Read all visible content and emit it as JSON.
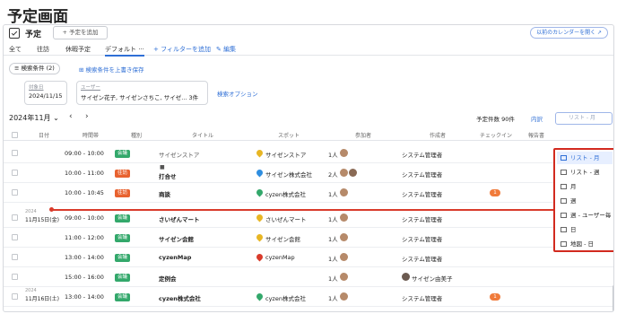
{
  "page_title": "予定画面",
  "header": {
    "title": "予定",
    "add_button": "+ 予定を追加",
    "prev_calendar_button": "以前のカレンダーを開く ↗"
  },
  "tabs": [
    "全て",
    "往訪",
    "休暇予定",
    "デフォルト ···",
    "+ フィルターを追加",
    "✎ 編集"
  ],
  "search": {
    "conditions_button": "≡ 検索条件 (2)",
    "save_conditions": "⊞ 検索条件を上書き保存",
    "target_date_label": "対象日",
    "target_date_value": "2024/11/15",
    "user_label": "ユーザー",
    "user_value": "サイゼン花子, サイゼンさちこ, サイゼ... 3件",
    "options_link": "検索オプション"
  },
  "toolbar": {
    "month": "2024年11月 ⌄",
    "prev": "‹",
    "next": "›",
    "count": "予定件数  90件",
    "naigai": "内訳",
    "view_select": "リスト - 月"
  },
  "table_headers": [
    "日付",
    "時間帯",
    "種別",
    "タイトル",
    "スポット",
    "参加者",
    "作成者",
    "チェックイン",
    "報告書"
  ],
  "colors": {
    "accent": "#2f6fd6",
    "kaigi": "#33a86b",
    "oubou": "#e8622f",
    "current_line": "#d93b2b",
    "dropdown_border": "#d22a1f"
  },
  "rows": [
    {
      "time": "09:00 - 10:00",
      "kind": "会議",
      "title": "サイゼンストア",
      "title_light": true,
      "spot": "サイゼンストア",
      "spot_color": "#e8b624",
      "participants": "1人",
      "creator": "システム管理者",
      "checkin": ""
    },
    {
      "time": "10:00 - 11:00",
      "kind": "往訪",
      "title": "打合せ",
      "title_light": false,
      "spot": "サイゼン株式会社",
      "spot_color": "#2f8ee0",
      "participants": "2人",
      "creator": "システム管理者",
      "checkin": ""
    },
    {
      "time": "10:00 - 10:45",
      "kind": "往訪",
      "title": "商談",
      "title_light": false,
      "spot": "cyzen株式会社",
      "spot_color": "#33a86b",
      "participants": "1人",
      "creator": "システム管理者",
      "checkin": "1"
    },
    {
      "date_year": "2024",
      "date_day": "11月15日(金)",
      "time": "09:00 - 10:00",
      "kind": "会議",
      "title": "さいぜんマート",
      "title_light": false,
      "spot": "さいぜんマート",
      "spot_color": "#e8b624",
      "participants": "1人",
      "creator": "システム管理者",
      "checkin": ""
    },
    {
      "time": "11:00 - 12:00",
      "kind": "会議",
      "title": "サイゼン会館",
      "title_light": false,
      "spot": "サイゼン会館",
      "spot_color": "#e8b624",
      "participants": "1人",
      "creator": "システム管理者",
      "checkin": ""
    },
    {
      "time": "13:00 - 14:00",
      "kind": "会議",
      "title": "cyzenMap",
      "title_light": false,
      "spot": "cyzenMap",
      "spot_color": "#d93b2b",
      "participants": "1人",
      "creator": "システム管理者",
      "checkin": ""
    },
    {
      "time": "15:00 - 16:00",
      "kind": "会議",
      "title": "定例会",
      "title_light": false,
      "spot": "",
      "spot_color": "",
      "participants": "1人",
      "creator": "サイゼン由美子",
      "checkin": ""
    },
    {
      "date_year": "2024",
      "date_day": "11月16日(土)",
      "time": "13:00 - 14:00",
      "kind": "会議",
      "title": "cyzen株式会社",
      "title_light": false,
      "spot": "cyzen株式会社",
      "spot_color": "#33a86b",
      "participants": "1人",
      "creator": "システム管理者",
      "checkin": "1"
    }
  ],
  "view_options": [
    "リスト - 月",
    "リスト - 週",
    "月",
    "週",
    "週 - ユーザー毎",
    "日",
    "地図 - 日"
  ]
}
